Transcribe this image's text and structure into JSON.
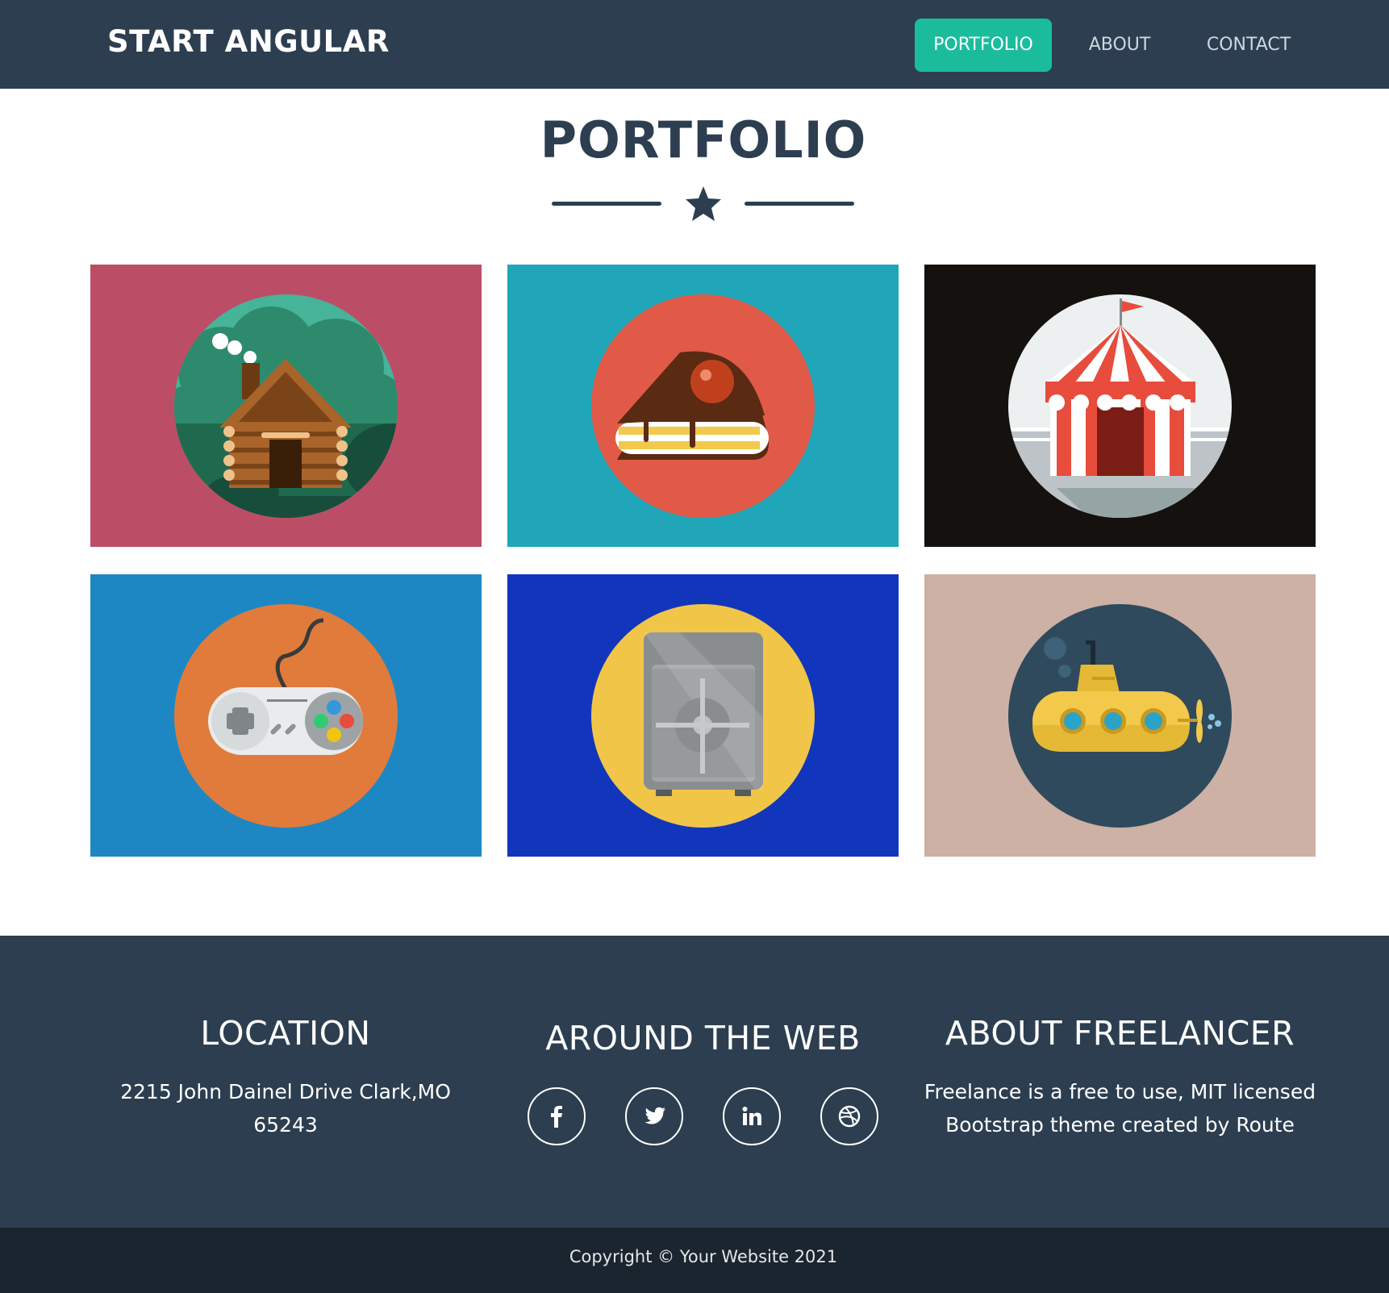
{
  "navbar": {
    "brand": "START ANGULAR",
    "links": [
      {
        "label": "PORTFOLIO",
        "active": true
      },
      {
        "label": "ABOUT",
        "active": false
      },
      {
        "label": "CONTACT",
        "active": false
      }
    ],
    "accent_color": "#1abc9c",
    "background_color": "#2c3e50"
  },
  "portfolio": {
    "title": "PORTFOLIO",
    "divider_icon": "star-icon",
    "items": [
      {
        "icon": "cabin-icon",
        "background": "#bb4e66"
      },
      {
        "icon": "cake-icon",
        "background": "#20a6b8"
      },
      {
        "icon": "circus-tent-icon",
        "background": "#14110f"
      },
      {
        "icon": "game-controller-icon",
        "background": "#1d87c4"
      },
      {
        "icon": "safe-icon",
        "background": "#1236bb"
      },
      {
        "icon": "submarine-icon",
        "background": "#cdb1a4"
      }
    ]
  },
  "footer": {
    "location": {
      "heading": "LOCATION",
      "address_line1": "2215 John Dainel Drive Clark,MO",
      "address_line2": "65243"
    },
    "web": {
      "heading": "AROUND THE WEB",
      "icons": [
        "facebook-icon",
        "twitter-icon",
        "linkedin-icon",
        "dribbble-icon"
      ]
    },
    "about": {
      "heading": "ABOUT FREELANCER",
      "line1": "Freelance is a free to use, MIT licensed",
      "line2": "Bootstrap theme created by Route"
    },
    "background_color": "#2c3e50"
  },
  "copyright": "Copyright © Your Website 2021"
}
